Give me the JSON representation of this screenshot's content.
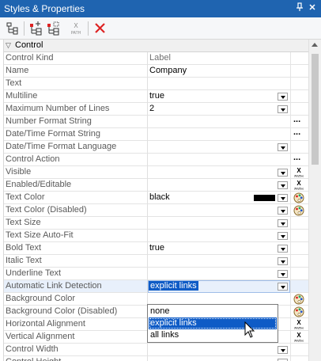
{
  "window": {
    "title": "Styles & Properties",
    "pin_glyph": "ₕ",
    "close_glyph": "×"
  },
  "toolbar": {
    "xpath_label": "X",
    "xpath_sub": "PATH"
  },
  "section": {
    "label": "Control"
  },
  "rows": [
    {
      "name": "Control Kind",
      "value": "Label",
      "value_gray": true
    },
    {
      "name": "Name",
      "value": "Company"
    },
    {
      "name": "Text",
      "value": ""
    },
    {
      "name": "Multiline",
      "value": "true",
      "dropdown": true
    },
    {
      "name": "Maximum Number of Lines",
      "value": "2",
      "dropdown": true
    },
    {
      "name": "Number Format String",
      "value": "",
      "ellipsis": true
    },
    {
      "name": "Date/Time Format String",
      "value": "",
      "ellipsis": true
    },
    {
      "name": "Date/Time Format Language",
      "value": "",
      "dropdown": true
    },
    {
      "name": "Control Action",
      "value": "",
      "ellipsis": true
    },
    {
      "name": "Visible",
      "value": "",
      "dropdown": true,
      "xpath": true
    },
    {
      "name": "Enabled/Editable",
      "value": "",
      "dropdown": true,
      "xpath": true
    },
    {
      "name": "Text Color",
      "value": "black",
      "dropdown": true,
      "palette": true,
      "swatch": "#000000"
    },
    {
      "name": "Text Color (Disabled)",
      "value": "",
      "dropdown": true,
      "palette": true
    },
    {
      "name": "Text Size",
      "value": "",
      "dropdown": true
    },
    {
      "name": "Text Size Auto-Fit",
      "value": "",
      "dropdown": true
    },
    {
      "name": "Bold Text",
      "value": "true",
      "dropdown": true
    },
    {
      "name": "Italic Text",
      "value": "",
      "dropdown": true
    },
    {
      "name": "Underline Text",
      "value": "",
      "dropdown": true
    },
    {
      "name": "Automatic Link Detection",
      "value": "explicit links",
      "dropdown": true,
      "highlight": true
    },
    {
      "name": "Background Color",
      "value": "",
      "palette": true
    },
    {
      "name": "Background Color (Disabled)",
      "value": "",
      "palette": true
    },
    {
      "name": "Horizontal Alignment",
      "value": "",
      "xpath": true
    },
    {
      "name": "Vertical Alignment",
      "value": "",
      "xpath": true
    },
    {
      "name": "Control Width",
      "value": "",
      "dropdown": true
    },
    {
      "name": "Control Height",
      "value": "",
      "dropdown": true
    }
  ],
  "dropdown": {
    "options": [
      "none",
      "explicit links",
      "all links"
    ],
    "selected": "explicit links"
  }
}
